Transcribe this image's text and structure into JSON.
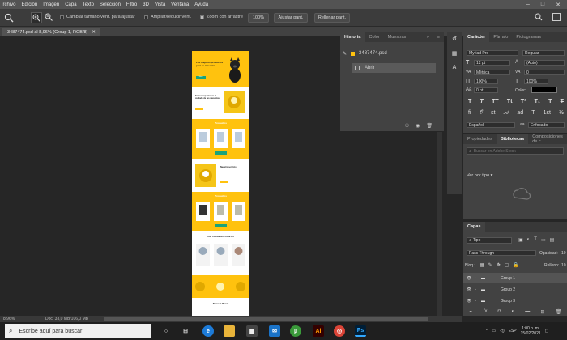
{
  "menu": [
    "rchivo",
    "Edición",
    "Imagen",
    "Capa",
    "Texto",
    "Selección",
    "Filtro",
    "3D",
    "Vista",
    "Ventana",
    "Ayuda"
  ],
  "window_controls": [
    "–",
    "□",
    "✕"
  ],
  "options": {
    "resize_label": "Cambiar tamaño vent. para ajustar",
    "zoom_all_label": "Ampliar/reducir vent.",
    "scrubby_label": "Zoom con arrastre",
    "percent_button": "100%",
    "fit_button": "Ajustar pant.",
    "fill_button": "Rellenar pant."
  },
  "document": {
    "tab_title": "3487474.psd al 8,96% (Group 1, RGB/8)",
    "close": "✕"
  },
  "doc_preview": {
    "hero_title": "Los mejores productos para tu mascota",
    "section2_title": "Somos expertos en el cuidado de tus mascotas",
    "section3_title": "Productos",
    "section4_title": "Nuestro servicio",
    "section5_title": "Productos",
    "section6_title": "Our customers love us",
    "section7_title": "Newest Posts",
    "button": "Shop"
  },
  "history_panel": {
    "tabs": [
      "Historia",
      "Color",
      "Muestras"
    ],
    "snapshot": "3487474.psd",
    "step": "Abrir"
  },
  "character_panel": {
    "tabs": [
      "Carácter",
      "Párrafo",
      "Pictogramas"
    ],
    "font": "Myriad Pro",
    "style": "Regular",
    "size": "12 pt",
    "leading": "(Auto)",
    "kerning": "Métrica",
    "tracking": "0",
    "vscale": "100%",
    "hscale": "100%",
    "baseline": "0 pt",
    "color_label": "Color:",
    "language": "Español",
    "antialias": "Enfocado",
    "color": "#000000"
  },
  "libraries_panel": {
    "tabs": [
      "Propiedades",
      "Bibliotecas",
      "Composiciones de c"
    ],
    "search_placeholder": "Buscar en Adobe Stock",
    "view_by": "Ver por tipo"
  },
  "layers_panel": {
    "tab": "Capas",
    "filter": "Tipo",
    "blend_mode": "Pass Through",
    "opacity_label": "Opacidad:",
    "opacity_value": "10",
    "lock_label": "Bloq.:",
    "fill_label": "Relleno:",
    "fill_value": "10",
    "layers": [
      "Group 1",
      "Group 2",
      "Group 3"
    ]
  },
  "status": {
    "zoom": "8,96%",
    "doc": "Doc: 33,0 MB/106,0 MB"
  },
  "taskbar": {
    "search_placeholder": "Escribe aquí para buscar",
    "lang": "ESP",
    "time": "1:00 p. m.",
    "date": "15/02/2021"
  },
  "colors": {
    "accent": "#ffc20e",
    "ps_blue": "#31a8ff"
  }
}
